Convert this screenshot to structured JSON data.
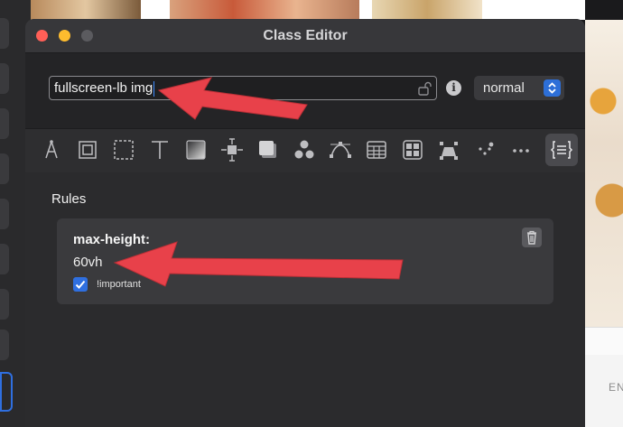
{
  "window": {
    "title": "Class Editor"
  },
  "selector": {
    "value": "fullscreen-lb img",
    "mode": "normal"
  },
  "toolbar_icons": [
    "compass-icon",
    "box-icon",
    "dashed-box-icon",
    "type-icon",
    "gradient-icon",
    "position-icon",
    "shadow-icon",
    "circles-icon",
    "bezier-icon",
    "table-icon",
    "grid-icon",
    "transform-icon",
    "dots-icon",
    "more-icon",
    "code-icon"
  ],
  "rules": {
    "heading": "Rules",
    "items": [
      {
        "property": "max-height:",
        "value": "60vh",
        "important_label": "!important",
        "important": true
      }
    ]
  },
  "background": {
    "right_text": "EN"
  },
  "colors": {
    "accent": "#2f6fe0",
    "annotation_arrow": "#e8414a"
  }
}
